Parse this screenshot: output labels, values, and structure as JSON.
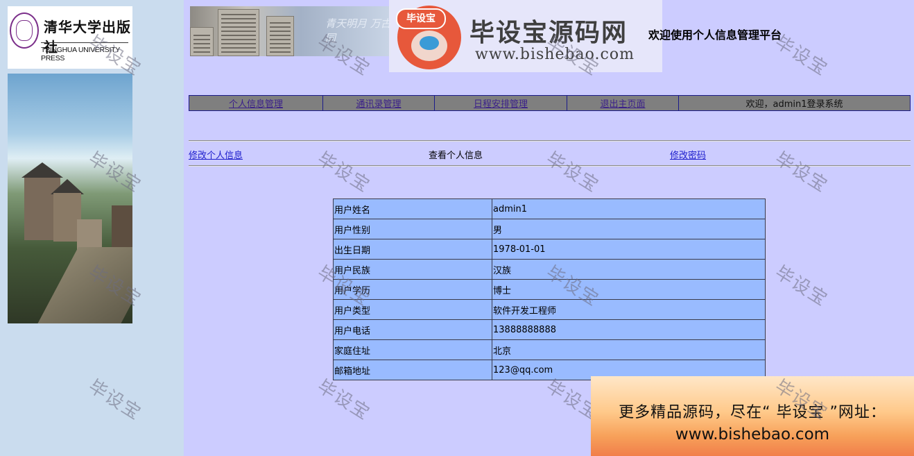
{
  "left": {
    "logo_cn": "清华大学出版社",
    "logo_en": "TSINGHUA UNIVERSITY PRESS"
  },
  "banner": {
    "script_text": "青天明月 万古同"
  },
  "watermark": {
    "badge": "毕设宝",
    "title": "毕设宝源码网",
    "url": "www.bishebao.com",
    "tile_text": "毕设宝"
  },
  "header": {
    "platform_title": "欢迎使用个人信息管理平台"
  },
  "nav": {
    "items": [
      {
        "label": "个人信息管理"
      },
      {
        "label": "通讯录管理"
      },
      {
        "label": "日程安排管理"
      },
      {
        "label": "退出主页面"
      }
    ],
    "welcome": "欢迎，admin1登录系统"
  },
  "subnav": {
    "edit_info": "修改个人信息",
    "view_info": "查看个人信息",
    "change_password": "修改密码"
  },
  "info": {
    "rows": [
      {
        "label": "用户姓名",
        "value": "admin1"
      },
      {
        "label": "用户性别",
        "value": "男"
      },
      {
        "label": "出生日期",
        "value": "1978-01-01"
      },
      {
        "label": "用户民族",
        "value": "汉族"
      },
      {
        "label": "用户学历",
        "value": "博士"
      },
      {
        "label": "用户类型",
        "value": "软件开发工程师"
      },
      {
        "label": "用户电话",
        "value": "13888888888"
      },
      {
        "label": "家庭住址",
        "value": "北京"
      },
      {
        "label": "邮箱地址",
        "value": "123@qq.com"
      }
    ]
  },
  "promo": {
    "line1": "更多精品源码，尽在“ 毕设宝 ”网址：",
    "line2": "www.bishebao.com"
  },
  "colors": {
    "main_bg": "#ccccff",
    "left_bg": "#cadcee",
    "nav_bg": "#7f7f7f",
    "table_bg": "#99bbff",
    "link": "#1d1dcc"
  }
}
